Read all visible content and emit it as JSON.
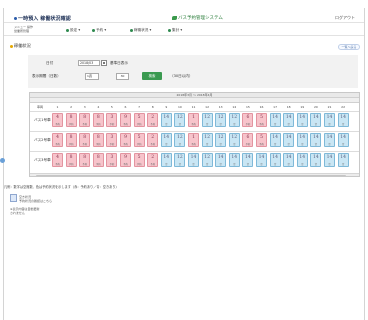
{
  "header": {
    "brand": "一時預入 稼働状況確認",
    "center_title": "バス予約管理システム",
    "user": "ログアウト"
  },
  "nav": {
    "prefix_line1": "メニュー 操作",
    "prefix_line2": "営業所管理",
    "items": [
      "設定",
      "予約",
      "稼働状況",
      "集計"
    ]
  },
  "section": {
    "title": "稼働状況",
    "back_button": "一覧へ戻る"
  },
  "form": {
    "date_label": "日付",
    "date_value": "2018/03",
    "date_suffix": "基準日表示",
    "range_label": "表示期間（日数）",
    "range_value": "1週",
    "count_value": "30",
    "search_button": "検索",
    "note": "（30日以内）"
  },
  "schedule": {
    "month_header": "2018年3月 ～ 2018年4月",
    "row_header": "車両",
    "days": [
      "1",
      "2",
      "3",
      "4",
      "5",
      "6",
      "7",
      "8",
      "9",
      "10",
      "11",
      "12",
      "13",
      "14",
      "15",
      "16",
      "17",
      "18",
      "19",
      "20",
      "21",
      "22"
    ],
    "rows": [
      {
        "label": "バス1号車",
        "cells": [
          {
            "n": "4",
            "s": "予約",
            "c": "pink"
          },
          {
            "n": "8",
            "s": "予約",
            "c": "pink"
          },
          {
            "n": "8",
            "s": "予約",
            "c": "pink"
          },
          {
            "n": "8",
            "s": "予約",
            "c": "pink"
          },
          {
            "n": "3",
            "s": "予約",
            "c": "pink"
          },
          {
            "n": "9",
            "s": "予約",
            "c": "pink"
          },
          {
            "n": "5",
            "s": "予約",
            "c": "pink"
          },
          {
            "n": "2",
            "s": "予約",
            "c": "pink"
          },
          {
            "n": "14",
            "s": "空",
            "c": "blue"
          },
          {
            "n": "12",
            "s": "空",
            "c": "blue"
          },
          {
            "n": "1",
            "s": "予約",
            "c": "pink"
          },
          {
            "n": "12",
            "s": "空",
            "c": "blue"
          },
          {
            "n": "12",
            "s": "空",
            "c": "blue"
          },
          {
            "n": "12",
            "s": "空",
            "c": "blue"
          },
          {
            "n": "6",
            "s": "予約",
            "c": "pink"
          },
          {
            "n": "5",
            "s": "予約",
            "c": "pink"
          },
          {
            "n": "14",
            "s": "空",
            "c": "blue"
          },
          {
            "n": "14",
            "s": "空",
            "c": "blue"
          },
          {
            "n": "14",
            "s": "空",
            "c": "blue"
          },
          {
            "n": "14",
            "s": "空",
            "c": "blue"
          },
          {
            "n": "14",
            "s": "空",
            "c": "blue"
          },
          {
            "n": "14",
            "s": "空",
            "c": "blue"
          }
        ]
      },
      {
        "label": "バス2号車",
        "cells": [
          {
            "n": "4",
            "s": "予約",
            "c": "pink"
          },
          {
            "n": "8",
            "s": "予約",
            "c": "pink"
          },
          {
            "n": "8",
            "s": "予約",
            "c": "pink"
          },
          {
            "n": "8",
            "s": "予約",
            "c": "pink"
          },
          {
            "n": "3",
            "s": "予約",
            "c": "pink"
          },
          {
            "n": "9",
            "s": "予約",
            "c": "pink"
          },
          {
            "n": "5",
            "s": "予約",
            "c": "pink"
          },
          {
            "n": "2",
            "s": "予約",
            "c": "pink"
          },
          {
            "n": "14",
            "s": "空",
            "c": "blue"
          },
          {
            "n": "12",
            "s": "空",
            "c": "blue"
          },
          {
            "n": "1",
            "s": "予約",
            "c": "pink"
          },
          {
            "n": "12",
            "s": "空",
            "c": "blue"
          },
          {
            "n": "12",
            "s": "空",
            "c": "blue"
          },
          {
            "n": "12",
            "s": "空",
            "c": "blue"
          },
          {
            "n": "6",
            "s": "予約",
            "c": "pink"
          },
          {
            "n": "5",
            "s": "予約",
            "c": "pink"
          },
          {
            "n": "14",
            "s": "空",
            "c": "blue"
          },
          {
            "n": "14",
            "s": "空",
            "c": "blue"
          },
          {
            "n": "14",
            "s": "空",
            "c": "blue"
          },
          {
            "n": "14",
            "s": "空",
            "c": "blue"
          },
          {
            "n": "14",
            "s": "空",
            "c": "blue"
          },
          {
            "n": "14",
            "s": "空",
            "c": "blue"
          }
        ]
      },
      {
        "label": "バス3号車",
        "cells": [
          {
            "n": "4",
            "s": "予約",
            "c": "pink"
          },
          {
            "n": "8",
            "s": "予約",
            "c": "pink"
          },
          {
            "n": "8",
            "s": "予約",
            "c": "pink"
          },
          {
            "n": "8",
            "s": "予約",
            "c": "pink"
          },
          {
            "n": "3",
            "s": "予約",
            "c": "pink"
          },
          {
            "n": "9",
            "s": "予約",
            "c": "pink"
          },
          {
            "n": "5",
            "s": "予約",
            "c": "pink"
          },
          {
            "n": "2",
            "s": "予約",
            "c": "pink"
          },
          {
            "n": "14",
            "s": "空",
            "c": "blue"
          },
          {
            "n": "12",
            "s": "空",
            "c": "blue"
          },
          {
            "n": "14",
            "s": "空",
            "c": "blue"
          },
          {
            "n": "12",
            "s": "空",
            "c": "blue"
          },
          {
            "n": "14",
            "s": "空",
            "c": "blue"
          },
          {
            "n": "14",
            "s": "空",
            "c": "blue"
          },
          {
            "n": "14",
            "s": "空",
            "c": "blue"
          },
          {
            "n": "14",
            "s": "空",
            "c": "blue"
          },
          {
            "n": "14",
            "s": "空",
            "c": "blue"
          },
          {
            "n": "14",
            "s": "空",
            "c": "blue"
          },
          {
            "n": "14",
            "s": "空",
            "c": "blue"
          },
          {
            "n": "14",
            "s": "空",
            "c": "blue"
          },
          {
            "n": "14",
            "s": "空",
            "c": "blue"
          },
          {
            "n": "14",
            "s": "空",
            "c": "blue"
          }
        ]
      }
    ]
  },
  "footer": {
    "legend_line": "凡例：数字は空席数、色は予約状況を示します（赤：予約あり／青：空きあり）",
    "box_label_1": "空き状況",
    "box_label_2": "予約状況の確認はこちら",
    "note_1": "※表示内容は自動更新",
    "note_2": "されません"
  }
}
